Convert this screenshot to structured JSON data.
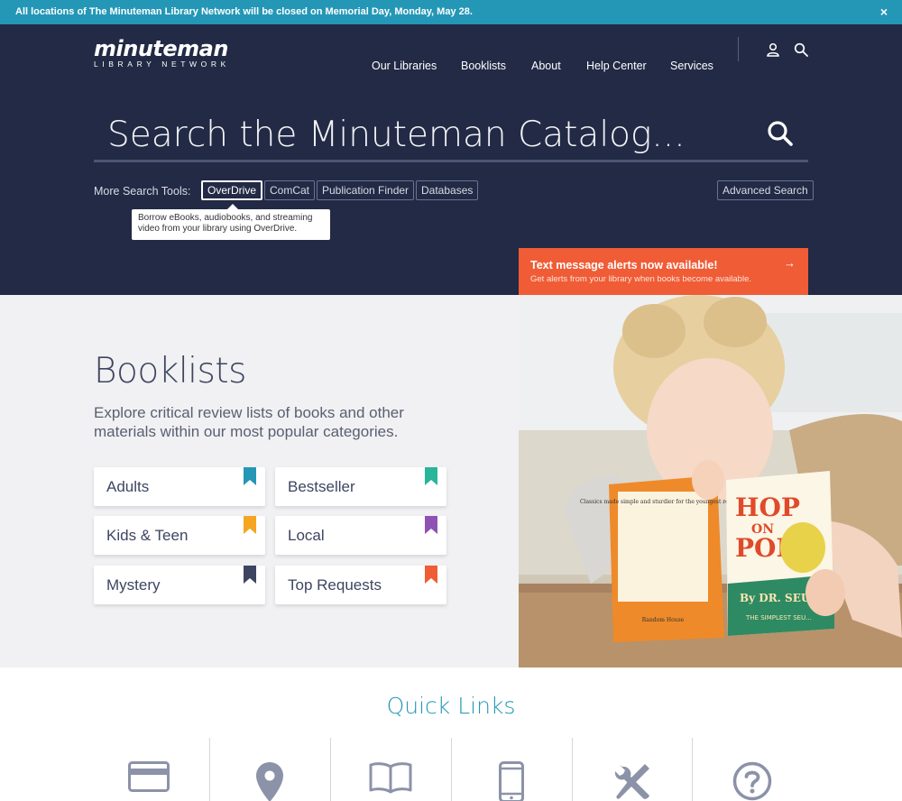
{
  "alert": {
    "text": "All locations of The Minuteman Library Network will be closed on Memorial Day, Monday, May 28.",
    "close_label": "×"
  },
  "logo": {
    "main": "minuteman",
    "sub": "LIBRARY NETWORK"
  },
  "nav": {
    "items": [
      "Our Libraries",
      "Booklists",
      "About",
      "Help Center",
      "Services"
    ],
    "icons": [
      "user-icon",
      "search-icon"
    ]
  },
  "search": {
    "placeholder": "Search the Minuteman Catalog..."
  },
  "search_tools": {
    "label": "More Search Tools:",
    "tools": [
      "OverDrive",
      "ComCat",
      "Publication Finder",
      "Databases"
    ],
    "advanced": "Advanced Search",
    "tooltip": "Borrow eBooks, audiobooks, and streaming video from your library using OverDrive."
  },
  "sms_banner": {
    "title": "Text message alerts now available!",
    "subtitle": "Get alerts from your library when books become available.",
    "arrow": "→"
  },
  "booklists": {
    "title": "Booklists",
    "description": "Explore critical review lists of books and other materials within our most popular categories.",
    "cards": [
      {
        "label": "Adults",
        "color": "#2497b6"
      },
      {
        "label": "Bestseller",
        "color": "#29b59a"
      },
      {
        "label": "Kids & Teen",
        "color": "#f4a522"
      },
      {
        "label": "Local",
        "color": "#8e52b5"
      },
      {
        "label": "Mystery",
        "color": "#3e4560"
      },
      {
        "label": "Top Requests",
        "color": "#ef5c36"
      }
    ]
  },
  "photo_book": {
    "title_lines": [
      "HOP",
      "ON",
      "POP"
    ],
    "author": "By DR. SEUSS",
    "tag": "THE SIMPLEST SEU...",
    "back_heading": "Classics made simple and sturdier for the youngest readers!",
    "publisher": "Random House"
  },
  "quick_links": {
    "title": "Quick Links",
    "icons": [
      "library-card-icon",
      "location-pin-icon",
      "open-book-icon",
      "mobile-phone-icon",
      "tools-icon",
      "help-question-icon"
    ]
  },
  "colors": {
    "alert_bar": "#2497b6",
    "hero": "#222a45",
    "accent_orange": "#ef5c36",
    "quick_links_title": "#2497b6"
  }
}
